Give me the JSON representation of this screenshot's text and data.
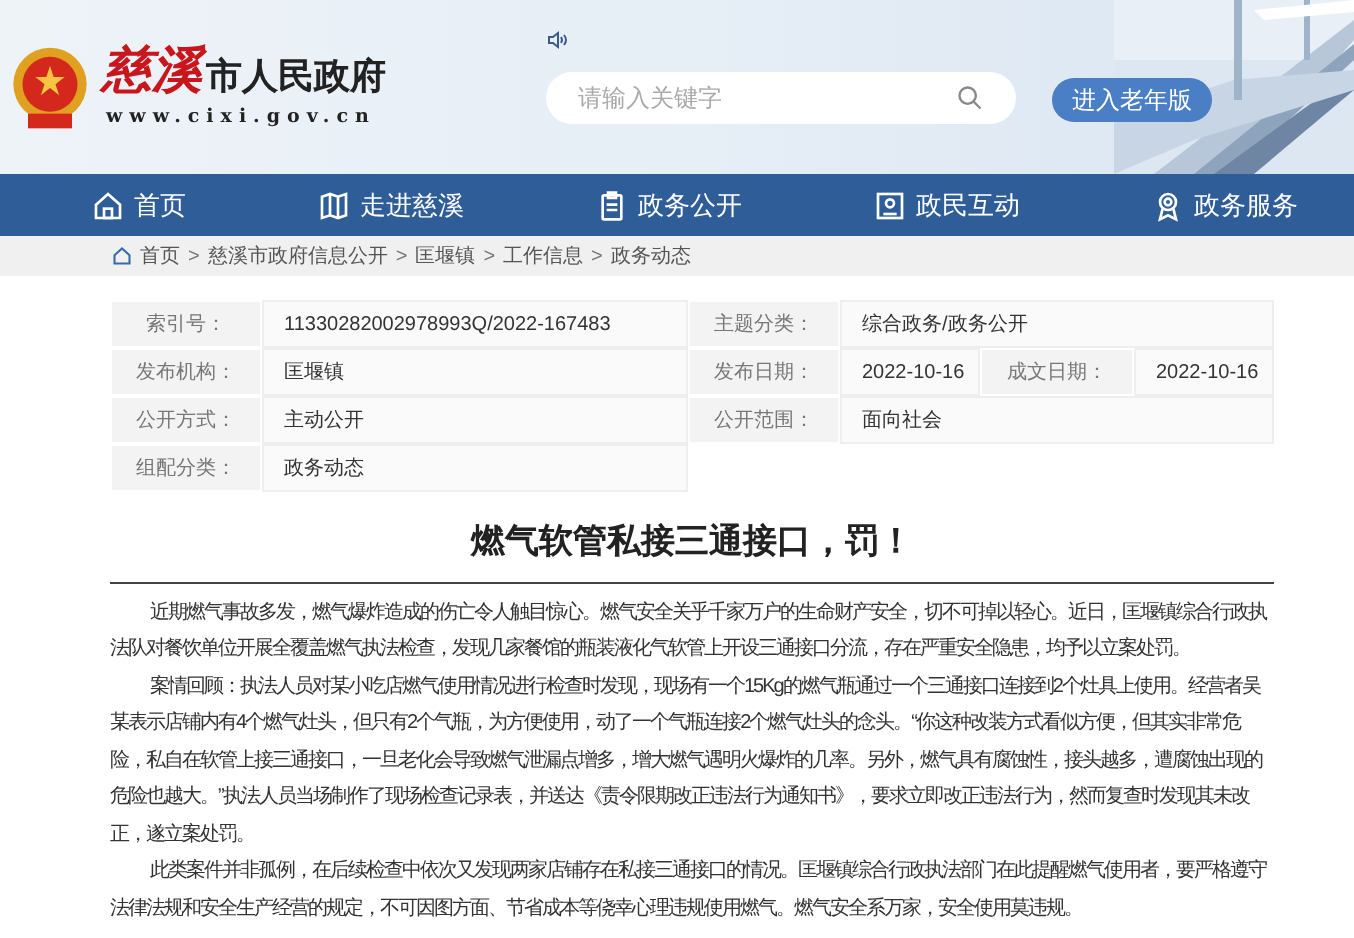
{
  "header": {
    "logo_script": "慈溪",
    "logo_title": "市人民政府",
    "logo_url": "www.cixi.gov.cn",
    "search": {
      "placeholder": "请输入关键字"
    },
    "elder_button": "进入老年版"
  },
  "nav": [
    {
      "label": "首页"
    },
    {
      "label": "走进慈溪"
    },
    {
      "label": "政务公开"
    },
    {
      "label": "政民互动"
    },
    {
      "label": "政务服务"
    }
  ],
  "breadcrumb": {
    "separator": ">",
    "items": [
      "首页",
      "慈溪市政府信息公开",
      "匡堰镇",
      "工作信息",
      "政务动态"
    ]
  },
  "meta": [
    [
      {
        "label": "索引号：",
        "value": "11330282002978993Q/2022-167483"
      },
      {
        "label": "主题分类：",
        "value": "综合政务/政务公开"
      }
    ],
    [
      {
        "label": "发布机构：",
        "value": "匡堰镇"
      },
      {
        "label": "发布日期：",
        "value": "2022-10-16"
      },
      {
        "label": "成文日期：",
        "value": "2022-10-16"
      }
    ],
    [
      {
        "label": "公开方式：",
        "value": "主动公开"
      },
      {
        "label": "公开范围：",
        "value": "面向社会"
      }
    ],
    [
      {
        "label": "组配分类：",
        "value": "政务动态"
      }
    ]
  ],
  "article": {
    "title": "燃气软管私接三通接口，罚！",
    "paragraphs": [
      "近期燃气事故多发，燃气爆炸造成的伤亡令人触目惊心。燃气安全关乎千家万户的生命财产安全，切不可掉以轻心。近日，匡堰镇综合行政执法队对餐饮单位开展全覆盖燃气执法检查，发现几家餐馆的瓶装液化气软管上开设三通接口分流，存在严重安全隐患，均予以立案处罚。",
      "案情回顾：执法人员对某小吃店燃气使用情况进行检查时发现，现场有一个15Kg的燃气瓶通过一个三通接口连接到2个灶具上使用。经营者吴某表示店铺内有4个燃气灶头，但只有2个气瓶，为方便使用，动了一个气瓶连接2个燃气灶头的念头。“你这种改装方式看似方便，但其实非常危险，私自在软管上接三通接口，一旦老化会导致燃气泄漏点增多，增大燃气遇明火爆炸的几率。另外，燃气具有腐蚀性，接头越多，遭腐蚀出现的危险也越大。”执法人员当场制作了现场检查记录表，并送达《责令限期改正违法行为通知书》，要求立即改正违法行为，然而复查时发现其未改正，遂立案处罚。",
      "此类案件并非孤例，在后续检查中依次又发现两家店铺存在私接三通接口的情况。匡堰镇综合行政执法部门在此提醒燃气使用者，要严格遵守法律法规和安全生产经营的规定，不可因图方面、节省成本等侥幸心理违规使用燃气。燃气安全系万家，安全使用莫违规。"
    ]
  }
}
